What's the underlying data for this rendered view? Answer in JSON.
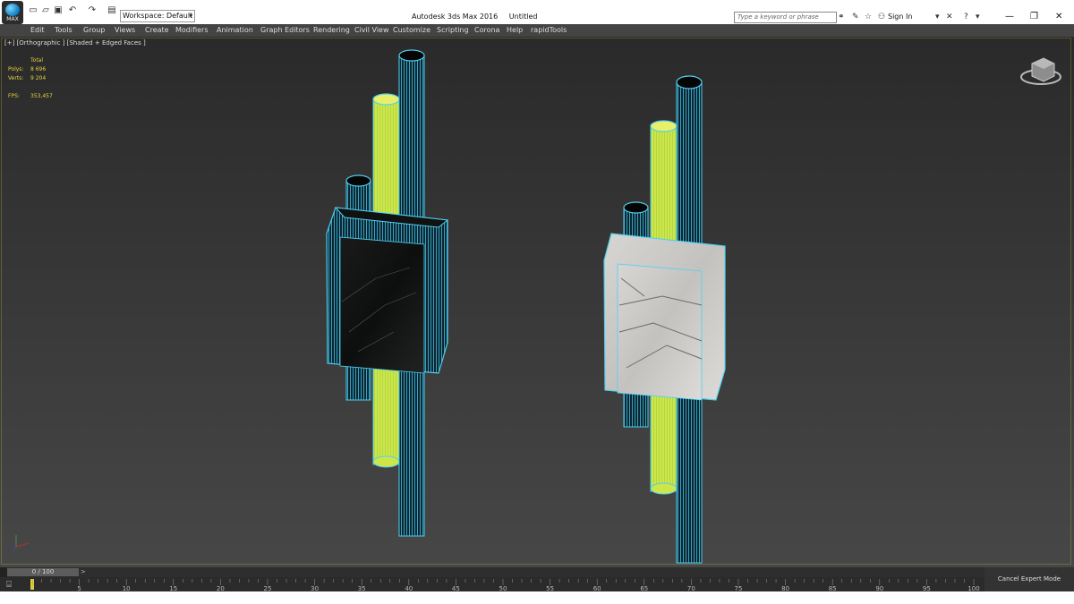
{
  "titlebar": {
    "app_name": "Autodesk 3ds Max 2016",
    "doc_name": "Untitled",
    "logo_text": "MAX",
    "workspace_label": "Workspace: Default",
    "search_placeholder": "Type a keyword or phrase",
    "sign_in": "Sign In"
  },
  "menu": [
    "Edit",
    "Tools",
    "Group",
    "Views",
    "Create",
    "Modifiers",
    "Animation",
    "Graph Editors",
    "Rendering",
    "Civil View",
    "Customize",
    "Scripting",
    "Corona",
    "Help",
    "rapidTools"
  ],
  "viewport": {
    "label": "[+] [Orthographic ] [Shaded + Edged Faces ]",
    "stats": {
      "header": "Total",
      "polys_label": "Polys:",
      "polys": "8 696",
      "verts_label": "Verts:",
      "verts": "9 204",
      "fps_label": "FPS:",
      "fps": "353,457"
    }
  },
  "timeline": {
    "frame": "0 / 100",
    "next_arrow": ">",
    "ticks": [
      "5",
      "10",
      "15",
      "20",
      "25",
      "30",
      "35",
      "40",
      "45",
      "50",
      "55",
      "60",
      "65",
      "70",
      "75",
      "80",
      "85",
      "90",
      "95",
      "100"
    ],
    "cancel_expert": "Cancel Expert Mode"
  },
  "colors": {
    "wire": "#4fd0f0",
    "accent_yellow": "#e6d23a",
    "menubar": "#444444"
  }
}
